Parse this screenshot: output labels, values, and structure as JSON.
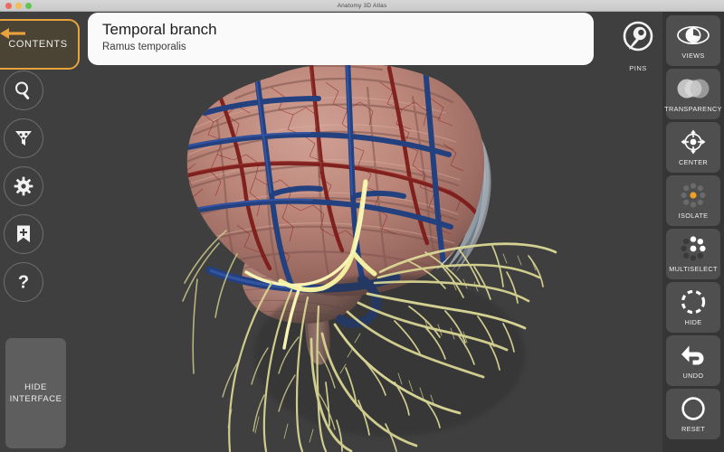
{
  "window": {
    "title": "Anatomy 3D Atlas",
    "traffic_lights": [
      "close",
      "minimize",
      "zoom"
    ]
  },
  "left_rail": {
    "contents_label": "CONTENTS",
    "back_arrow_icon": "back-arrow-icon",
    "icons": [
      {
        "name": "search-icon",
        "glyph": "search"
      },
      {
        "name": "filter-icon",
        "glyph": "funnel"
      },
      {
        "name": "settings-icon",
        "glyph": "gear"
      },
      {
        "name": "bookmark-add-icon",
        "glyph": "bookmark-plus"
      },
      {
        "name": "help-icon",
        "glyph": "question"
      }
    ],
    "hide_interface_label": "HIDE\nINTERFACE",
    "hide_interface_line1": "HIDE",
    "hide_interface_line2": "INTERFACE"
  },
  "info_card": {
    "title": "Temporal branch",
    "subtitle": "Ramus temporalis"
  },
  "pins": {
    "label": "PINS",
    "icon": "pin-icon"
  },
  "right_rail": {
    "tools": [
      {
        "label": "VIEWS",
        "icon": "eye-icon"
      },
      {
        "label": "TRANSPARENCY",
        "icon": "overlapping-circles-icon"
      },
      {
        "label": "CENTER",
        "icon": "crosshair-icon"
      },
      {
        "label": "ISOLATE",
        "icon": "isolate-dots-icon"
      },
      {
        "label": "MULTISELECT",
        "icon": "multiselect-dots-icon"
      },
      {
        "label": "HIDE",
        "icon": "dashed-circle-icon"
      },
      {
        "label": "UNDO",
        "icon": "undo-arrow-icon"
      },
      {
        "label": "RESET",
        "icon": "circle-outline-icon"
      }
    ]
  },
  "viewport": {
    "model_name": "brain-with-facial-nerve-branches",
    "background_color": "#3f3f3f",
    "colors": {
      "cortex": "#b98277",
      "vein_blue": "#2a4b93",
      "artery_red": "#7c1d1c",
      "nerve_yellow": "#e8e47e",
      "accent_orange": "#e8a33d",
      "panel_gray": "#4f4f4f",
      "rail_gray": "#353535"
    }
  }
}
